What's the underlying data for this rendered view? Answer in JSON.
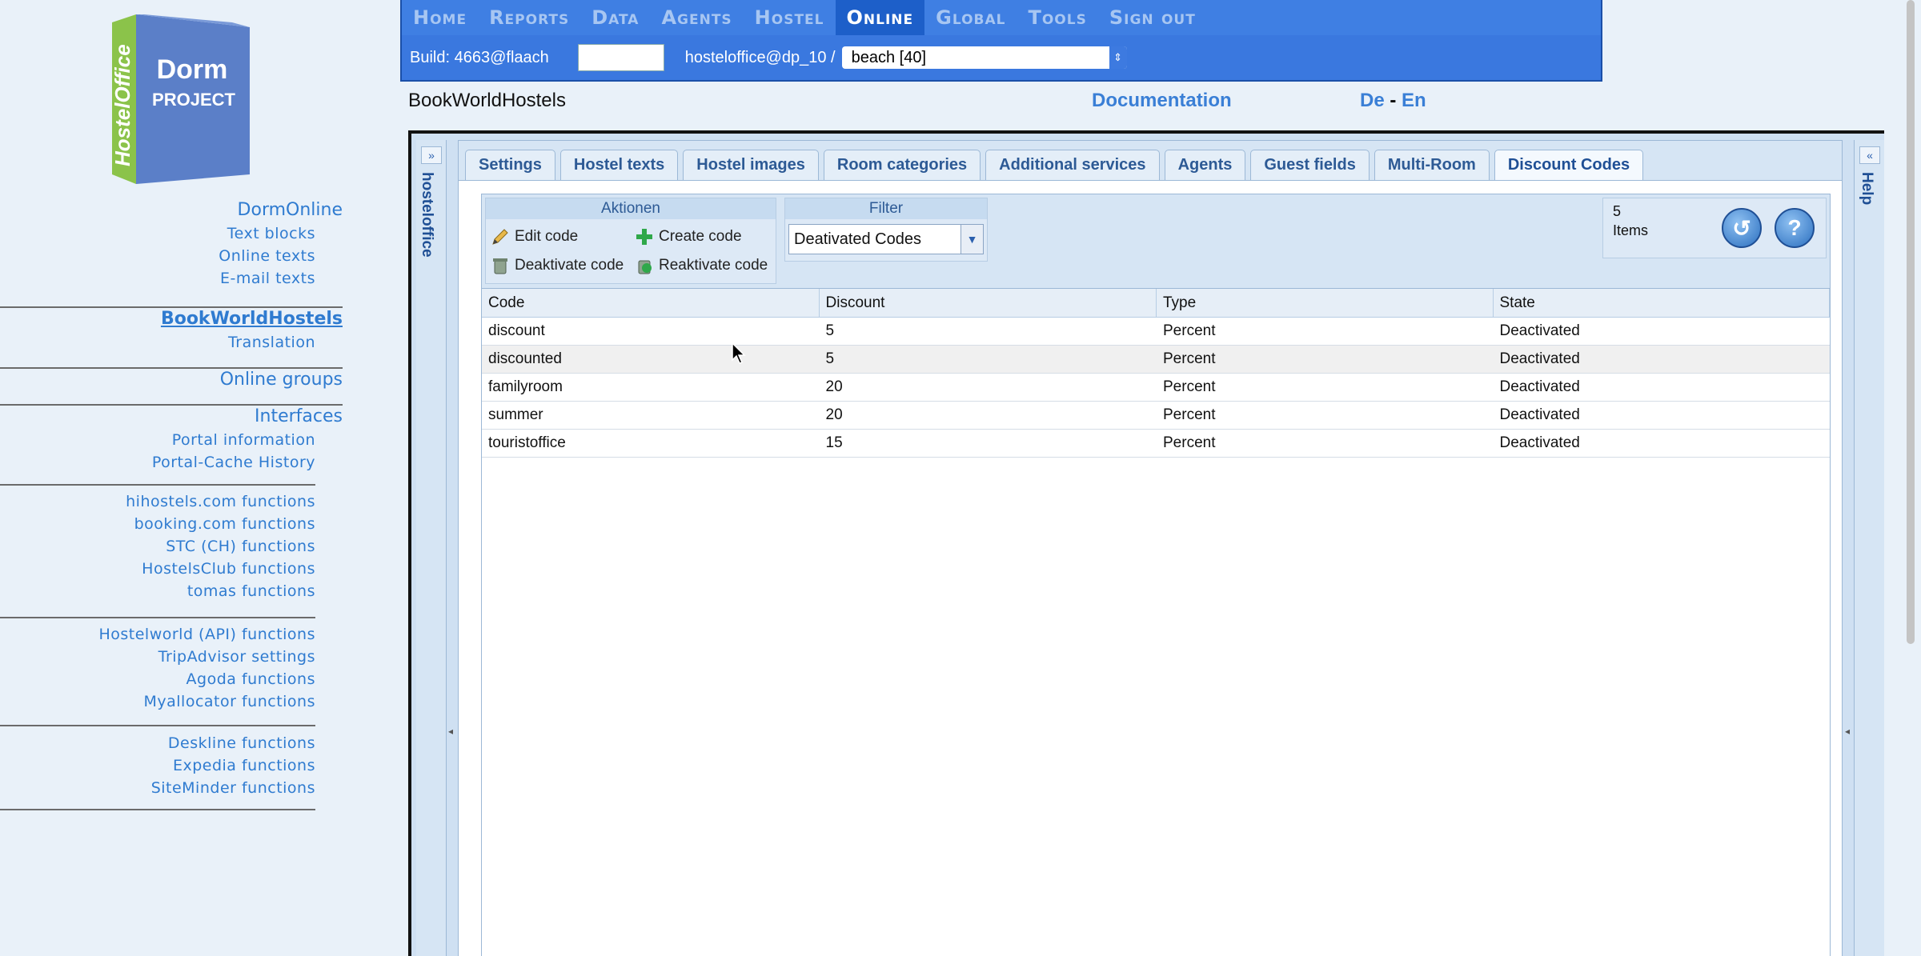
{
  "sidebar": {
    "logo": {
      "text1": "Dorm",
      "text2": "PROJECT",
      "vertical": "HostelOffice"
    },
    "sections": [
      {
        "head": "DormOnline",
        "items": [
          "Text blocks",
          "Online texts",
          "E-mail texts"
        ]
      },
      {
        "head": "BookWorldHostels",
        "items": [
          "Translation"
        ]
      },
      {
        "head": "Online groups",
        "items": []
      },
      {
        "head": "Interfaces",
        "items": [
          "Portal information",
          "Portal-Cache History"
        ]
      }
    ],
    "groups": [
      [
        "hihostels.com functions",
        "booking.com functions",
        "STC (CH) functions",
        "HostelsClub functions",
        "tomas functions"
      ],
      [
        "Hostelworld (API) functions",
        "TripAdvisor settings",
        "Agoda functions",
        "Myallocator functions"
      ],
      [
        "Deskline functions",
        "Expedia functions",
        "SiteMinder functions"
      ]
    ]
  },
  "menu": [
    "Home",
    "Reports",
    "Data",
    "Agents",
    "Hostel",
    "Online",
    "Global",
    "Tools",
    "Sign out"
  ],
  "build": {
    "label": "Build: 4663@flaach",
    "user": "hosteloffice@dp_10 /",
    "hostel": "beach [40]"
  },
  "header": {
    "site": "BookWorldHostels",
    "doc": "Documentation",
    "lang_de": "De",
    "lang_sep": "-",
    "lang_en": "En"
  },
  "strips": {
    "left": "hosteloffice",
    "right": "Help",
    "left_btn": "»",
    "right_btn": "«"
  },
  "tabs": [
    "Settings",
    "Hostel texts",
    "Hostel images",
    "Room categories",
    "Additional services",
    "Agents",
    "Guest fields",
    "Multi-Room",
    "Discount Codes"
  ],
  "actions": {
    "title": "Aktionen",
    "edit": "Edit code",
    "create": "Create code",
    "deactivate": "Deaktivate code",
    "reactivate": "Reaktivate code"
  },
  "filter": {
    "title": "Filter",
    "value": "Deativated Codes"
  },
  "counter": {
    "count": "5",
    "label": "Items"
  },
  "grid": {
    "columns": [
      "Code",
      "Discount",
      "Type",
      "State"
    ],
    "rows": [
      [
        "discount",
        "5",
        "Percent",
        "Deactivated"
      ],
      [
        "discounted",
        "5",
        "Percent",
        "Deactivated"
      ],
      [
        "familyroom",
        "20",
        "Percent",
        "Deactivated"
      ],
      [
        "summer",
        "20",
        "Percent",
        "Deactivated"
      ],
      [
        "touristoffice",
        "15",
        "Percent",
        "Deactivated"
      ]
    ]
  },
  "colors": {
    "menu_bg": "#3f7fe3",
    "menu_active": "#1d5fc9",
    "link": "#2f7bd0"
  }
}
